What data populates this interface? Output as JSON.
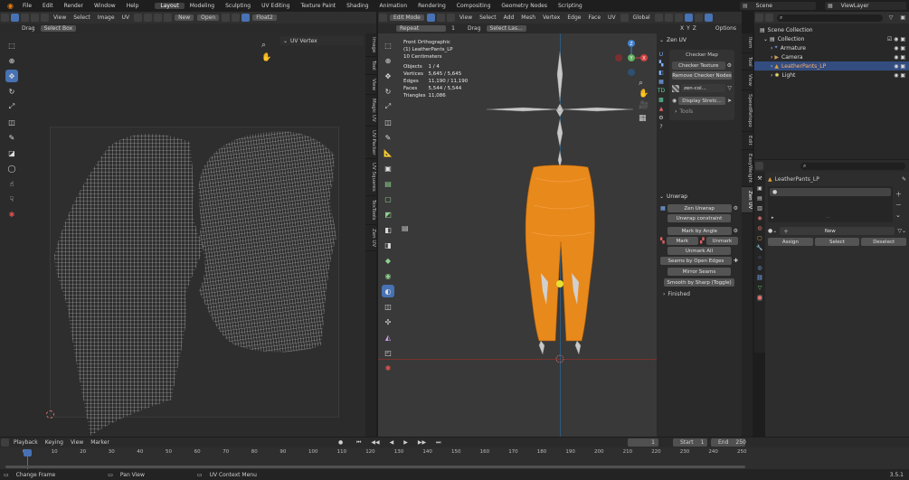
{
  "menu": {
    "items": [
      "File",
      "Edit",
      "Render",
      "Window",
      "Help"
    ],
    "workspaces": [
      "Layout",
      "Modeling",
      "Sculpting",
      "UV Editing",
      "Texture Paint",
      "Shading",
      "Animation",
      "Rendering",
      "Compositing",
      "Geometry Nodes",
      "Scripting"
    ],
    "active_workspace": "Layout",
    "scene": "Scene",
    "view_layer": "ViewLayer"
  },
  "uv_editor": {
    "header": {
      "view": "View",
      "select": "Select",
      "image": "Image",
      "uv": "UV",
      "new": "New",
      "open": "Open",
      "image_name": "Float2"
    },
    "subheader": {
      "drag": "Drag",
      "select_box": "Select Box"
    },
    "panel_title": "UV Vertex",
    "tabs": [
      "Image",
      "Tool",
      "View",
      "Magic UV",
      "UV-Packer",
      "UV Squares",
      "TexTools",
      "Zen UV"
    ]
  },
  "viewport": {
    "header": {
      "mode": "Edit Mode",
      "view": "View",
      "select": "Select",
      "add": "Add",
      "mesh": "Mesh",
      "vertex": "Vertex",
      "edge": "Edge",
      "face": "Face",
      "uv": "UV",
      "orientation": "Global",
      "options": "Options"
    },
    "subheader": {
      "repeat": "Repeat",
      "repeat_count": "1",
      "drag": "Drag",
      "select_last": "Select Las..."
    },
    "overlay": {
      "view_name": "Front Orthographic",
      "object_name": "(1) LeatherPants_LP",
      "scale": "10 Centimeters",
      "stats": [
        {
          "label": "Objects",
          "value": "1 / 4"
        },
        {
          "label": "Vertices",
          "value": "5,645 / 5,645"
        },
        {
          "label": "Edges",
          "value": "11,190 / 11,190"
        },
        {
          "label": "Faces",
          "value": "5,544 / 5,544"
        },
        {
          "label": "Triangles",
          "value": "11,086"
        }
      ]
    },
    "gizmo": {
      "x": "X",
      "y": "Y",
      "z": "Z"
    },
    "xyz_toggles": [
      "X",
      "Y",
      "Z"
    ]
  },
  "zen_uv": {
    "title": "Zen UV",
    "checker_map": "Checker Map",
    "checker_texture": "Checker Texture",
    "remove_checker": "Remove Checker Nodes",
    "texture_name": "zen-col...",
    "display_stretch": "Display Stretc...",
    "tools": "Tools",
    "unwrap_title": "Unwrap",
    "zen_unwrap": "Zen Unwrap",
    "unwrap_constraint": "Unwrap constraint",
    "mark_by_angle": "Mark by Angle",
    "mark": "Mark",
    "unmark": "Unmark",
    "unmark_all": "Unmark All",
    "seams_by_open_edges": "Seams by Open Edges",
    "mirror_seams": "Mirror Seams",
    "smooth_by_sharp": "Smooth by Sharp (Toggle)",
    "finished": "Finished",
    "tabs": [
      "Item",
      "Tool",
      "View",
      "SpeedRetopo",
      "Edit",
      "EasyWeight",
      "Zen UV"
    ]
  },
  "outliner": {
    "items": [
      {
        "name": "Scene Collection",
        "indent": 0,
        "selected": false
      },
      {
        "name": "Collection",
        "indent": 1,
        "selected": false
      },
      {
        "name": "Armature",
        "indent": 2,
        "selected": false
      },
      {
        "name": "Camera",
        "indent": 2,
        "selected": false
      },
      {
        "name": "LeatherPants_LP",
        "indent": 2,
        "selected": true
      },
      {
        "name": "Light",
        "indent": 2,
        "selected": false
      }
    ]
  },
  "properties": {
    "object_name": "LeatherPants_LP",
    "new": "New",
    "assign": "Assign",
    "select": "Select",
    "deselect": "Deselect"
  },
  "timeline": {
    "playback": "Playback",
    "keying": "Keying",
    "view": "View",
    "marker": "Marker",
    "current_frame": "1",
    "start_label": "Start",
    "start": "1",
    "end_label": "End",
    "end": "250",
    "ticks": [
      "0",
      "10",
      "20",
      "30",
      "40",
      "50",
      "60",
      "70",
      "80",
      "90",
      "100",
      "110",
      "120",
      "130",
      "140",
      "150",
      "160",
      "170",
      "180",
      "190",
      "200",
      "210",
      "220",
      "230",
      "240",
      "250"
    ]
  },
  "status": {
    "items": [
      "Change Frame",
      "Pan View",
      "UV Context Menu"
    ],
    "version": "3.5.1"
  },
  "colors": {
    "accent": "#4772b3",
    "mesh_orange": "#e8891c",
    "selected_row": "#334d80"
  }
}
